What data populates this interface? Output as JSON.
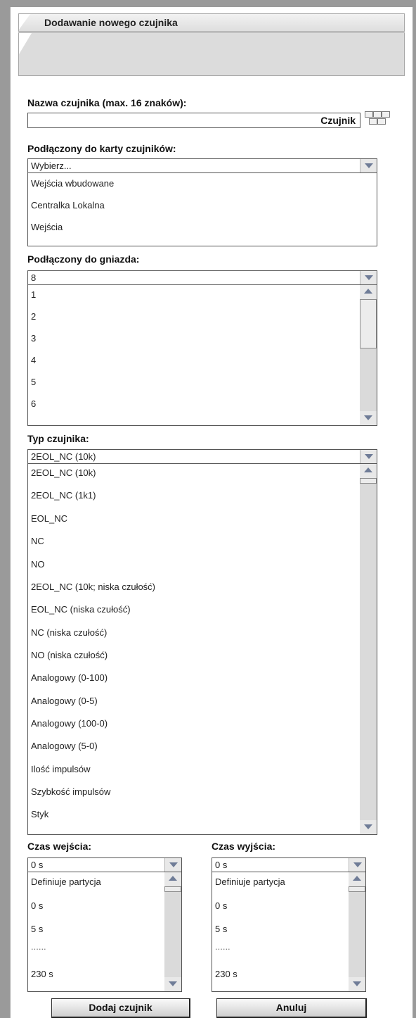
{
  "window": {
    "title": "Dodawanie nowego czujnika"
  },
  "sensor_name": {
    "label": "Nazwa czujnika (max. 16 znaków):",
    "value": "Czujnik"
  },
  "card": {
    "label": "Podłączony do karty czujników:",
    "selected": "Wybierz...",
    "options": [
      "Wejścia wbudowane",
      "Centralka Lokalna",
      "Wejścia"
    ]
  },
  "socket": {
    "label": "Podłączony do gniazda:",
    "selected": "8",
    "options": [
      "1",
      "2",
      "3",
      "4",
      "5",
      "6"
    ]
  },
  "sensor_type": {
    "label": "Typ czujnika:",
    "selected": "2EOL_NC (10k)",
    "options": [
      "2EOL_NC (10k)",
      "2EOL_NC (1k1)",
      "EOL_NC",
      "NC",
      "NO",
      "2EOL_NC (10k; niska czułość)",
      "EOL_NC (niska czułość)",
      "NC (niska czułość)",
      "NO (niska czułość)",
      "Analogowy (0-100)",
      "Analogowy (0-5)",
      "Analogowy (100-0)",
      "Analogowy (5-0)",
      "Ilość impulsów",
      "Szybkość impulsów",
      "Styk"
    ]
  },
  "entry_time": {
    "label": "Czas wejścia:",
    "selected": "0 s",
    "options": [
      "Definiuje partycja",
      "0 s",
      "5 s",
      "......",
      "230 s"
    ]
  },
  "exit_time": {
    "label": "Czas wyjścia:",
    "selected": "0 s",
    "options": [
      "Definiuje partycja",
      "0 s",
      "5 s",
      "......",
      "230 s"
    ]
  },
  "buttons": {
    "add": "Dodaj czujnik",
    "cancel": "Anuluj"
  },
  "colors": {
    "arrow": "#6f7c97",
    "panel_bg": "#dcdcdc",
    "frame": "#9a9a9a"
  }
}
